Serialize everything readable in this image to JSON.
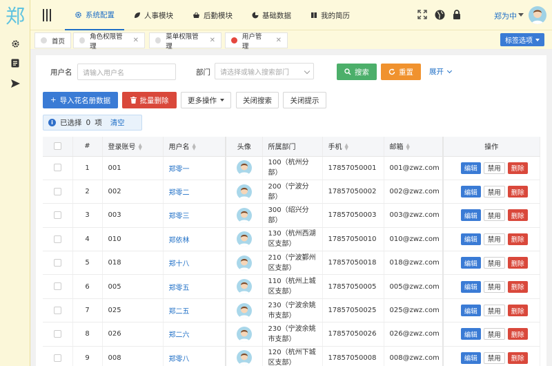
{
  "logo": "郑",
  "header": {
    "nav": [
      {
        "label": "系统配置",
        "icon": "gear-icon"
      },
      {
        "label": "人事模块",
        "icon": "leaf-icon"
      },
      {
        "label": "后勤模块",
        "icon": "basket-icon"
      },
      {
        "label": "基础数据",
        "icon": "pie-icon"
      },
      {
        "label": "我的简历",
        "icon": "book-icon"
      }
    ],
    "user_name": "郑为中"
  },
  "tabs": [
    {
      "label": "首页"
    },
    {
      "label": "角色权限管理"
    },
    {
      "label": "菜单权限管理"
    },
    {
      "label": "用户管理"
    }
  ],
  "tab_options_label": "标签选项",
  "search": {
    "username_label": "用户名",
    "username_placeholder": "请输入用户名",
    "dept_label": "部门",
    "dept_placeholder": "请选择或输入搜索部门",
    "search_label": "搜索",
    "reset_label": "重置",
    "expand_label": "展开"
  },
  "toolbar": {
    "import_label": "导入花名册数据",
    "batch_delete_label": "批量删除",
    "more_label": "更多操作",
    "close_search_label": "关闭搜索",
    "close_tips_label": "关闭提示"
  },
  "selection": {
    "prefix": "已选择",
    "count": "0",
    "suffix": "项",
    "clear_label": "清空"
  },
  "table": {
    "headers": {
      "index": "#",
      "account": "登录账号",
      "username": "用户名",
      "avatar": "头像",
      "dept": "所属部门",
      "phone": "手机",
      "email": "邮箱",
      "ops": "操作"
    },
    "ops": {
      "edit": "编辑",
      "ban": "禁用",
      "delete": "删除"
    },
    "rows": [
      {
        "index": "1",
        "account": "001",
        "username": "郑零一",
        "dept": "100（杭州分部）",
        "phone": "17857050001",
        "email": "001@zwz.com"
      },
      {
        "index": "2",
        "account": "002",
        "username": "郑零二",
        "dept": "200（宁波分部）",
        "phone": "17857050002",
        "email": "002@zwz.com"
      },
      {
        "index": "3",
        "account": "003",
        "username": "郑零三",
        "dept": "300（绍兴分部）",
        "phone": "17857050003",
        "email": "003@zwz.com"
      },
      {
        "index": "4",
        "account": "010",
        "username": "郑依林",
        "dept": "130（杭州西湖区支部）",
        "phone": "17857050010",
        "email": "010@zwz.com"
      },
      {
        "index": "5",
        "account": "018",
        "username": "郑十八",
        "dept": "210（宁波鄞州区支部）",
        "phone": "17857050018",
        "email": "018@zwz.com"
      },
      {
        "index": "6",
        "account": "005",
        "username": "郑零五",
        "dept": "110（杭州上城区支部）",
        "phone": "17857050005",
        "email": "005@zwz.com"
      },
      {
        "index": "7",
        "account": "025",
        "username": "郑二五",
        "dept": "230（宁波余姚市支部）",
        "phone": "17857050025",
        "email": "025@zwz.com"
      },
      {
        "index": "8",
        "account": "026",
        "username": "郑二六",
        "dept": "230（宁波余姚市支部）",
        "phone": "17857050026",
        "email": "026@zwz.com"
      },
      {
        "index": "9",
        "account": "008",
        "username": "郑零八",
        "dept": "120（杭州下城区支部）",
        "phone": "17857050008",
        "email": "008@zwz.com"
      }
    ]
  }
}
